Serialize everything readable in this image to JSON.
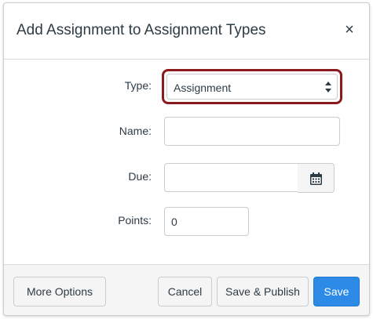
{
  "dialog": {
    "title": "Add Assignment to Assignment Types",
    "close_label": "×"
  },
  "form": {
    "type_label": "Type:",
    "type_value": "Assignment",
    "name_label": "Name:",
    "name_value": "",
    "due_label": "Due:",
    "due_value": "",
    "points_label": "Points:",
    "points_value": "0"
  },
  "footer": {
    "more_options_label": "More Options",
    "cancel_label": "Cancel",
    "save_publish_label": "Save & Publish",
    "save_label": "Save"
  },
  "colors": {
    "primary": "#2d8ae6",
    "highlight_border": "#8b1a1f",
    "text": "#2d3b45"
  },
  "icons": {
    "close": "close-icon",
    "select_arrows": "updown-arrows-icon",
    "calendar": "calendar-icon"
  }
}
